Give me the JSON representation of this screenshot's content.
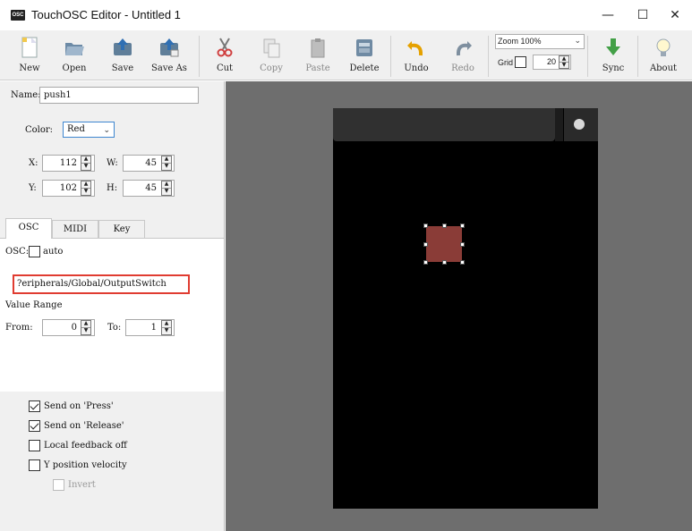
{
  "window": {
    "app_icon_text": "OSC",
    "title": "TouchOSC Editor - Untitled 1",
    "controls": {
      "minimize": "—",
      "maximize": "☐",
      "close": "✕"
    }
  },
  "toolbar": {
    "buttons": [
      {
        "label": "New",
        "icon": "new-document-icon",
        "enabled": true
      },
      {
        "label": "Open",
        "icon": "folder-open-icon",
        "enabled": true
      },
      {
        "label": "Save",
        "icon": "save-upload-icon",
        "enabled": true
      },
      {
        "label": "Save As",
        "icon": "save-as-icon",
        "enabled": true
      },
      {
        "label": "Cut",
        "icon": "scissors-icon",
        "enabled": true
      },
      {
        "label": "Copy",
        "icon": "copy-icon",
        "enabled": false
      },
      {
        "label": "Paste",
        "icon": "paste-icon",
        "enabled": false
      },
      {
        "label": "Delete",
        "icon": "delete-icon",
        "enabled": true
      },
      {
        "label": "Undo",
        "icon": "undo-arrow-icon",
        "enabled": true
      },
      {
        "label": "Redo",
        "icon": "redo-arrow-icon",
        "enabled": false
      },
      {
        "label": "Sync",
        "icon": "sync-down-arrow-icon",
        "enabled": true
      },
      {
        "label": "About",
        "icon": "lightbulb-icon",
        "enabled": true
      }
    ],
    "zoom": {
      "label": "Zoom",
      "value": "100%"
    },
    "grid": {
      "label": "Grid",
      "checked": false,
      "value": "20"
    }
  },
  "properties": {
    "name_label": "Name:",
    "name_value": "push1",
    "color_label": "Color:",
    "color_value": "Red",
    "x_label": "X:",
    "x_value": "112",
    "w_label": "W:",
    "w_value": "45",
    "y_label": "Y:",
    "y_value": "102",
    "h_label": "H:",
    "h_value": "45"
  },
  "tabs": [
    {
      "label": "OSC",
      "active": true
    },
    {
      "label": "MIDI",
      "active": false
    },
    {
      "label": "Key",
      "active": false
    }
  ],
  "osc": {
    "osc_label": "OSC:",
    "auto_label": "auto",
    "auto_checked": false,
    "address": "?eripherals/Global/OutputSwitch",
    "value_range_label": "Value Range",
    "from_label": "From:",
    "from_value": "0",
    "to_label": "To:",
    "to_value": "1"
  },
  "options": {
    "send_on_press": {
      "label": "Send on 'Press'",
      "checked": true
    },
    "send_on_release": {
      "label": "Send on 'Release'",
      "checked": true
    },
    "local_feedback_off": {
      "label": "Local feedback off",
      "checked": false
    },
    "y_position_velocity": {
      "label": "Y position velocity",
      "checked": false
    },
    "invert": {
      "label": "Invert",
      "checked": false,
      "enabled": false
    }
  },
  "colors": {
    "accent_red": "#e03c31",
    "push_control_red": "#8a3c37",
    "canvas_bg": "#6e6e6e",
    "device_bg": "#000000"
  }
}
